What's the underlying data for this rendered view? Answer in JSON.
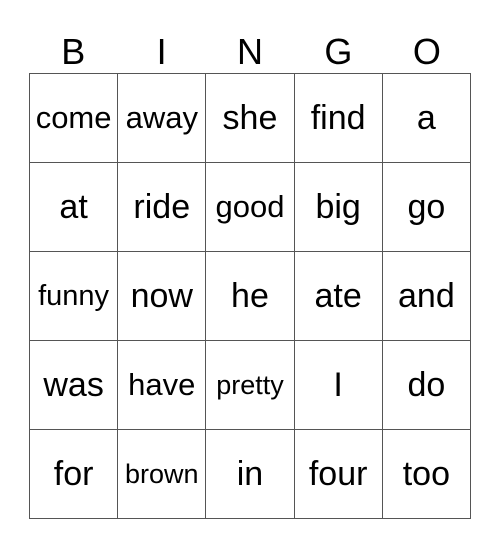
{
  "header": [
    "B",
    "I",
    "N",
    "G",
    "O"
  ],
  "cells": [
    [
      "come",
      "away",
      "she",
      "find",
      "a"
    ],
    [
      "at",
      "ride",
      "good",
      "big",
      "go"
    ],
    [
      "funny",
      "now",
      "he",
      "ate",
      "and"
    ],
    [
      "was",
      "have",
      "pretty",
      "I",
      "do"
    ],
    [
      "for",
      "brown",
      "in",
      "four",
      "too"
    ]
  ]
}
